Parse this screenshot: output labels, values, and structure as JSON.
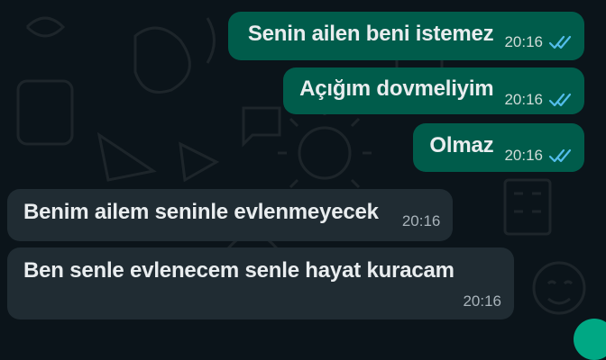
{
  "chat": {
    "messages": [
      {
        "direction": "outgoing",
        "text": "Senin ailen beni istemez",
        "time": "20:16",
        "status": "read"
      },
      {
        "direction": "outgoing",
        "text": "Açığım dovmeliyim",
        "time": "20:16",
        "status": "read"
      },
      {
        "direction": "outgoing",
        "text": "Olmaz",
        "time": "20:16",
        "status": "read"
      },
      {
        "direction": "incoming",
        "text": "Benim ailem seninle evlenmeyecek",
        "time": "20:16"
      },
      {
        "direction": "incoming",
        "text": "Ben senle evlenecem senle hayat kuracam",
        "time": "20:16"
      }
    ]
  },
  "colors": {
    "background": "#0b141a",
    "outgoing_bubble": "#005c4b",
    "incoming_bubble": "#202c33",
    "read_ticks": "#53bdeb",
    "fab": "#00a884"
  },
  "icons": {
    "read_receipt": "double-check-icon"
  }
}
